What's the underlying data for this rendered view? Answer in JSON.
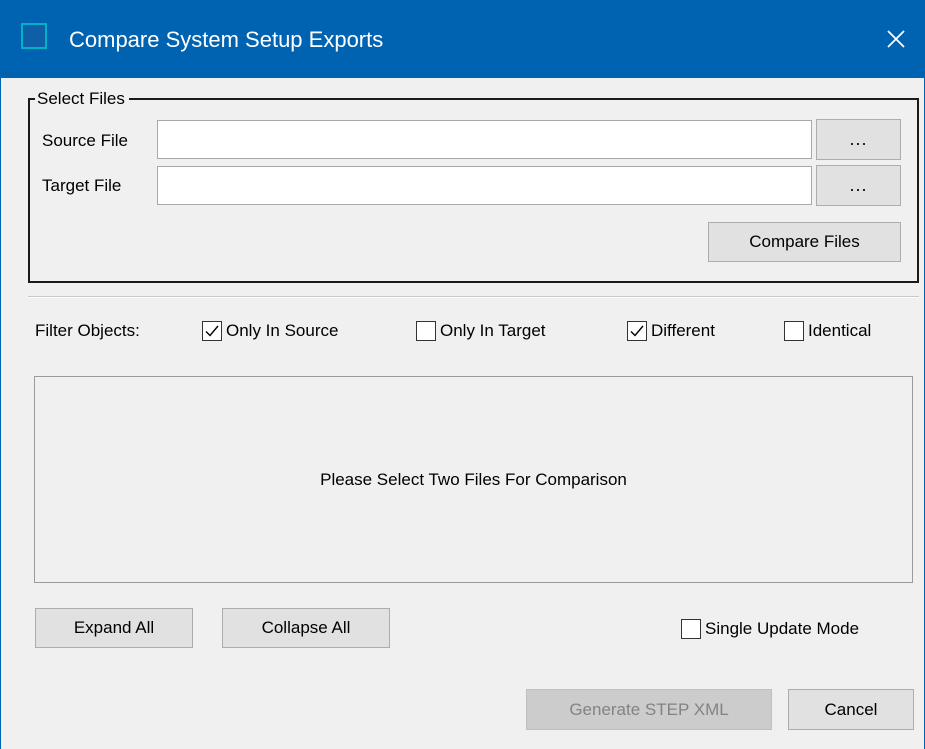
{
  "window": {
    "title": "Compare System Setup Exports",
    "accent_color": "#0063b1",
    "icons": {
      "app": "app-window-icon",
      "close": "close-icon"
    }
  },
  "select_files": {
    "group_title": "Select Files",
    "source": {
      "label": "Source File",
      "value": "",
      "browse_label": "..."
    },
    "target": {
      "label": "Target File",
      "value": "",
      "browse_label": "..."
    },
    "compare_button": "Compare Files"
  },
  "filters": {
    "label": "Filter Objects:",
    "options": [
      {
        "label": "Only In Source",
        "checked": true
      },
      {
        "label": "Only In Target",
        "checked": false
      },
      {
        "label": "Different",
        "checked": true
      },
      {
        "label": "Identical",
        "checked": false
      }
    ]
  },
  "results": {
    "message": "Please Select Two Files For Comparison"
  },
  "actions": {
    "expand_all": "Expand All",
    "collapse_all": "Collapse All",
    "single_update_mode": {
      "label": "Single Update Mode",
      "checked": false
    },
    "generate_button": {
      "label": "Generate STEP XML",
      "enabled": false
    },
    "cancel_button": "Cancel"
  }
}
